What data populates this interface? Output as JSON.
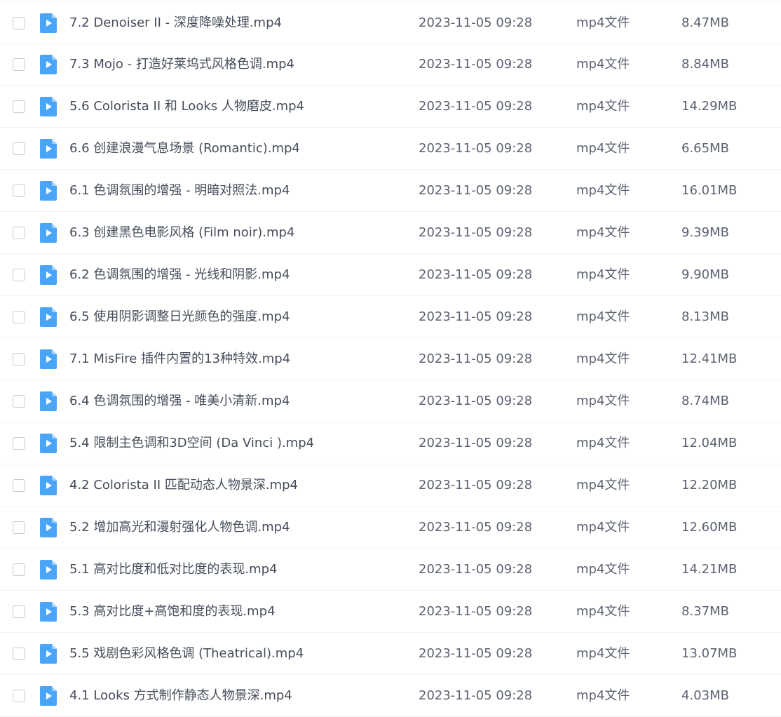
{
  "icon": {
    "name": "video-file-icon",
    "color": "#4aa5f7"
  },
  "files": [
    {
      "name": "7.2 Denoiser II  - 深度降噪处理.mp4",
      "date": "2023-11-05 09:28",
      "type": "mp4文件",
      "size": "8.47MB"
    },
    {
      "name": "7.3 Mojo - 打造好莱坞式风格色调.mp4",
      "date": "2023-11-05 09:28",
      "type": "mp4文件",
      "size": "8.84MB"
    },
    {
      "name": "5.6 Colorista II 和 Looks 人物磨皮.mp4",
      "date": "2023-11-05 09:28",
      "type": "mp4文件",
      "size": "14.29MB"
    },
    {
      "name": "6.6 创建浪漫气息场景 (Romantic).mp4",
      "date": "2023-11-05 09:28",
      "type": "mp4文件",
      "size": "6.65MB"
    },
    {
      "name": "6.1 色调氛围的增强 - 明暗对照法.mp4",
      "date": "2023-11-05 09:28",
      "type": "mp4文件",
      "size": "16.01MB"
    },
    {
      "name": "6.3 创建黑色电影风格 (Film noir).mp4",
      "date": "2023-11-05 09:28",
      "type": "mp4文件",
      "size": "9.39MB"
    },
    {
      "name": "6.2 色调氛围的增强 - 光线和阴影.mp4",
      "date": "2023-11-05 09:28",
      "type": "mp4文件",
      "size": "9.90MB"
    },
    {
      "name": "6.5 使用阴影调整日光颜色的强度.mp4",
      "date": "2023-11-05 09:28",
      "type": "mp4文件",
      "size": "8.13MB"
    },
    {
      "name": "7.1 MisFire 插件内置的13种特效.mp4",
      "date": "2023-11-05 09:28",
      "type": "mp4文件",
      "size": "12.41MB"
    },
    {
      "name": "6.4 色调氛围的增强 - 唯美小清新.mp4",
      "date": "2023-11-05 09:28",
      "type": "mp4文件",
      "size": "8.74MB"
    },
    {
      "name": "5.4 限制主色调和3D空间 (Da Vinci ).mp4",
      "date": "2023-11-05 09:28",
      "type": "mp4文件",
      "size": "12.04MB"
    },
    {
      "name": "4.2 Colorista II 匹配动态人物景深.mp4",
      "date": "2023-11-05 09:28",
      "type": "mp4文件",
      "size": "12.20MB"
    },
    {
      "name": "5.2 增加高光和漫射强化人物色调.mp4",
      "date": "2023-11-05 09:28",
      "type": "mp4文件",
      "size": "12.60MB"
    },
    {
      "name": "5.1 高对比度和低对比度的表现.mp4",
      "date": "2023-11-05 09:28",
      "type": "mp4文件",
      "size": "14.21MB"
    },
    {
      "name": "5.3 高对比度+高饱和度的表现.mp4",
      "date": "2023-11-05 09:28",
      "type": "mp4文件",
      "size": "8.37MB"
    },
    {
      "name": "5.5 戏剧色彩风格色调 (Theatrical).mp4",
      "date": "2023-11-05 09:28",
      "type": "mp4文件",
      "size": "13.07MB"
    },
    {
      "name": "4.1 Looks 方式制作静态人物景深.mp4",
      "date": "2023-11-05 09:28",
      "type": "mp4文件",
      "size": "4.03MB"
    }
  ]
}
